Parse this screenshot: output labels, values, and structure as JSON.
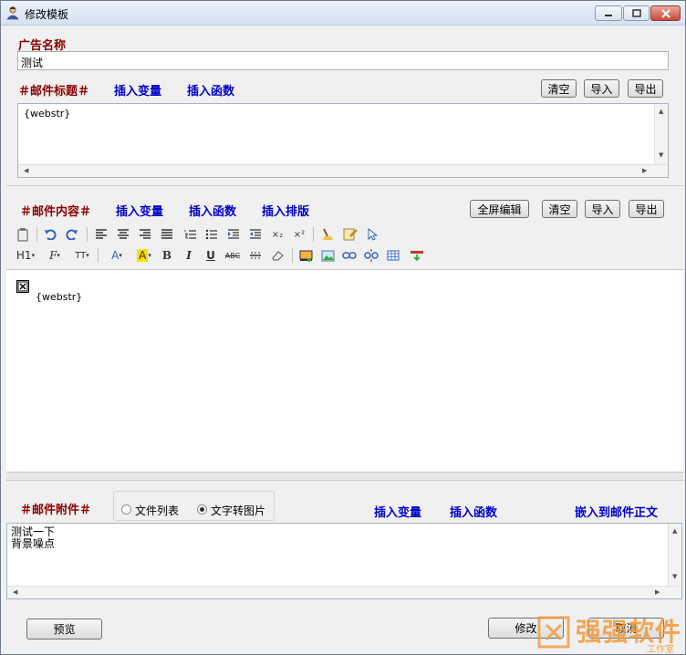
{
  "window": {
    "title": "修改模板",
    "controls": {
      "minimize": "minimize",
      "maximize": "maximize",
      "close": "close"
    }
  },
  "ad_name": {
    "label": "广告名称",
    "value": "测试"
  },
  "subject": {
    "label": "＃邮件标题＃",
    "insert_variable": "插入变量",
    "insert_function": "插入函数",
    "clear": "清空",
    "import": "导入",
    "export": "导出",
    "value": "{webstr}"
  },
  "content": {
    "label": "＃邮件内容＃",
    "insert_variable": "插入变量",
    "insert_function": "插入函数",
    "insert_layout": "插入排版",
    "fullscreen_edit": "全屏编辑",
    "clear": "清空",
    "import": "导入",
    "export": "导出",
    "body_text": "{webstr}",
    "toolbar_row1": [
      "paste-icon",
      "undo-icon",
      "redo-icon",
      "align-left-icon",
      "align-center-icon",
      "align-right-icon",
      "align-justify-icon",
      "ordered-list-icon",
      "unordered-list-icon",
      "indent-icon",
      "outdent-icon",
      "subscript-icon",
      "superscript-icon",
      "clean-icon",
      "format-painter-icon",
      "select-icon"
    ],
    "toolbar_row2": [
      "heading-icon",
      "font-family-icon",
      "font-size-icon",
      "font-color-icon",
      "highlight-icon",
      "bold-icon",
      "italic-icon",
      "underline-icon",
      "strikethrough-icon",
      "hr-icon",
      "eraser-icon",
      "image-icon",
      "picture-icon",
      "link-icon",
      "unlink-icon",
      "table-icon",
      "insert-row-icon"
    ],
    "toolbar_text": {
      "h1": "H1",
      "font": "F",
      "size": "TT",
      "color": "A",
      "highlight": "A",
      "bold": "B",
      "italic": "I",
      "underline": "U",
      "strike": "ABC",
      "sub": "×₂",
      "sup": "×²"
    }
  },
  "attachment": {
    "label": "＃邮件附件＃",
    "radio_file_list": "文件列表",
    "radio_text_to_image": "文字转图片",
    "selected": "text_to_image",
    "insert_variable": "插入变量",
    "insert_function": "插入函数",
    "embed_in_body": "嵌入到邮件正文",
    "lines": [
      "测试一下",
      "背景噪点"
    ]
  },
  "footer": {
    "preview": "预览",
    "modify": "修改",
    "cancel": "取消"
  },
  "watermark": {
    "text": "强强软件",
    "sub": "工作室"
  },
  "colors": {
    "red_label": "#8b0000",
    "blue_link": "#0000cc",
    "watermark": "#f39a3a"
  }
}
